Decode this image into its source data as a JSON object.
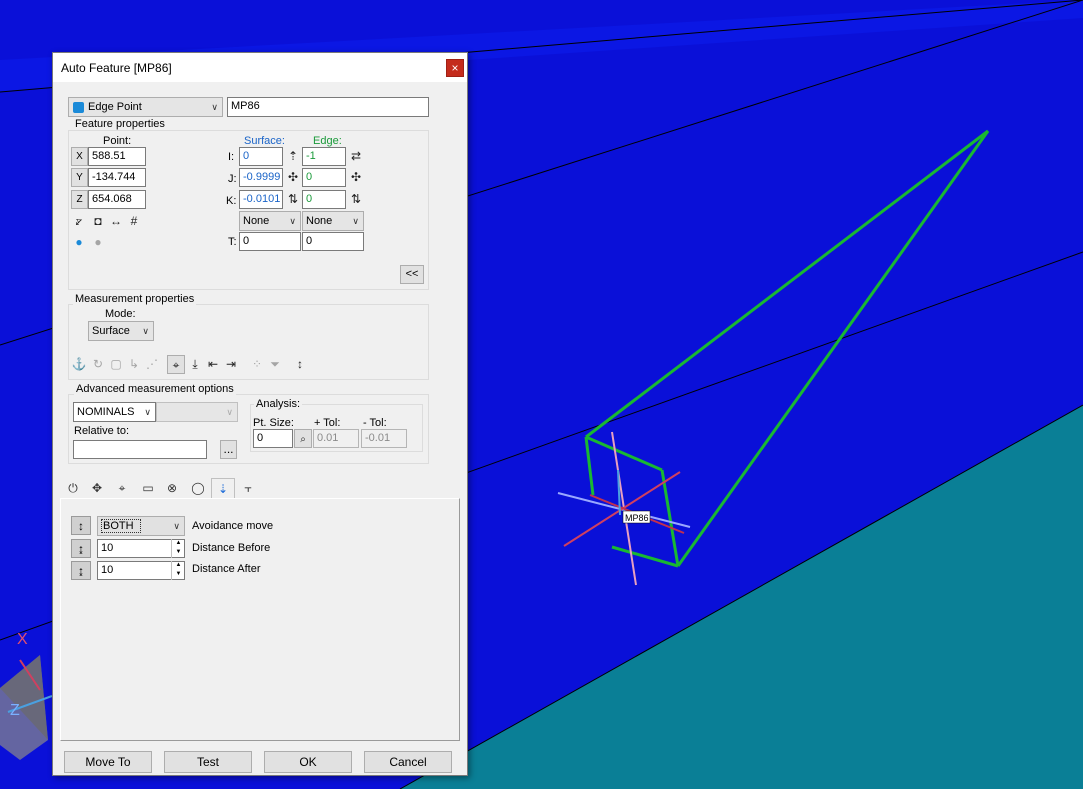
{
  "dialog": {
    "title": "Auto Feature [MP86]",
    "close_glyph": "×",
    "feature_type": "Edge Point",
    "feature_id": "MP86"
  },
  "feature_properties": {
    "group_label": "Feature properties",
    "point_label": "Point:",
    "surface_label": "Surface:",
    "edge_label": "Edge:",
    "x_label": "X",
    "y_label": "Y",
    "z_label": "Z",
    "x": "588.51",
    "y": "-134.744",
    "z": "654.068",
    "i_label": "I:",
    "j_label": "J:",
    "k_label": "K:",
    "t_label": "T:",
    "surface_i": "0",
    "surface_j": "-0.9999",
    "surface_k": "-0.0101",
    "edge_i": "-1",
    "edge_j": "0",
    "edge_k": "0",
    "surface_none": "None",
    "edge_none": "None",
    "surface_t": "0",
    "edge_t": "0",
    "collapse_label": "<<"
  },
  "measurement_properties": {
    "group_label": "Measurement properties",
    "mode_label": "Mode:",
    "mode_value": "Surface"
  },
  "advanced": {
    "group_label": "Advanced measurement options",
    "nominals": "NOMINALS",
    "relative_to_label": "Relative to:",
    "browse_label": "...",
    "analysis_label": "Analysis:",
    "pt_size_label": "Pt. Size:",
    "plus_tol_label": "+ Tol:",
    "minus_tol_label": "- Tol:",
    "pt_size": "0",
    "plus_tol": "0.01",
    "minus_tol": "-0.01"
  },
  "avoidance": {
    "mode": "BOTH",
    "mode_label": "Avoidance move",
    "distance_before": "10",
    "distance_before_label": "Distance Before",
    "distance_after": "10",
    "distance_after_label": "Distance After"
  },
  "buttons": {
    "move_to": "Move To",
    "test": "Test",
    "ok": "OK",
    "cancel": "Cancel"
  },
  "viewport": {
    "point_tag": "MP86",
    "axis_x": "X",
    "axis_z": "Z"
  },
  "colors": {
    "background": "#0a10d8",
    "floor": "#0a7f96",
    "wireframe": "#19b832"
  }
}
